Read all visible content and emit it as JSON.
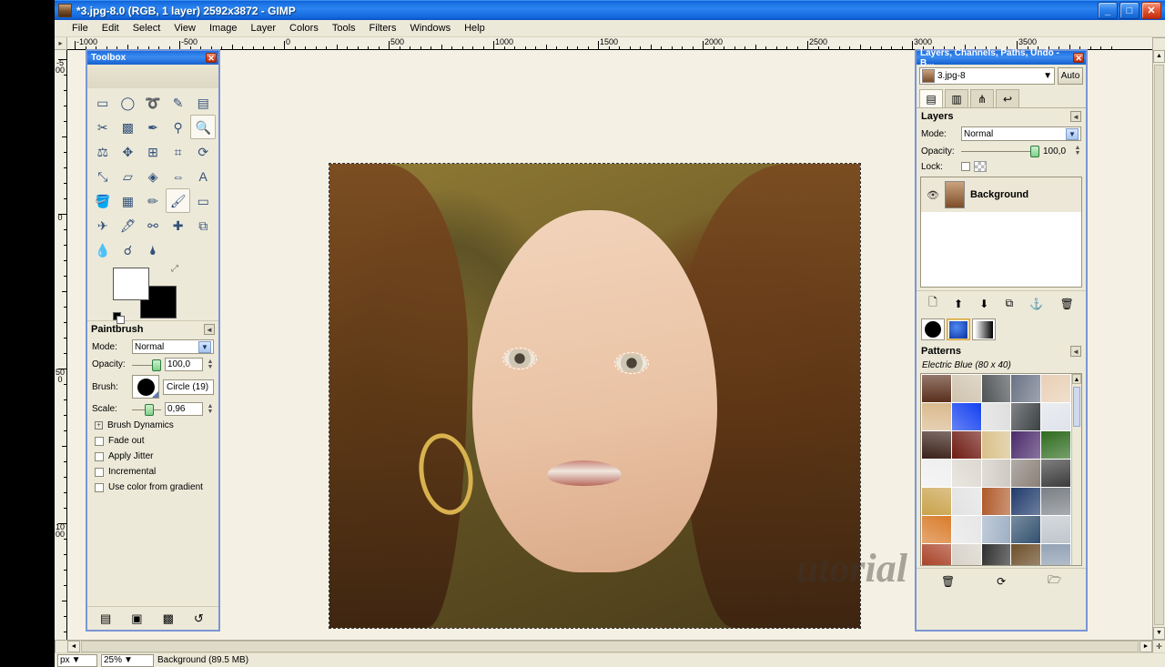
{
  "window": {
    "title": "*3.jpg-8.0 (RGB, 1 layer) 2592x3872 - GIMP",
    "minimize": "_",
    "maximize": "□",
    "close": "✕"
  },
  "menu": [
    "File",
    "Edit",
    "Select",
    "View",
    "Image",
    "Layer",
    "Colors",
    "Tools",
    "Filters",
    "Windows",
    "Help"
  ],
  "rulers": {
    "horizontal": [
      "-1000",
      "-500",
      "0",
      "500",
      "1000",
      "1500",
      "2000",
      "2500",
      "3000",
      "3500"
    ],
    "vertical": [
      "-500",
      "0",
      "500",
      "1000"
    ],
    "unit_menu": "▸"
  },
  "canvas": {
    "watermark": "utorial"
  },
  "toolbox": {
    "title": "Toolbox",
    "close": "✕",
    "tools": [
      {
        "name": "rect-select-tool",
        "glyph": "▭"
      },
      {
        "name": "ellipse-select-tool",
        "glyph": "◯"
      },
      {
        "name": "free-select-tool",
        "glyph": "➰"
      },
      {
        "name": "fuzzy-select-tool",
        "glyph": "✎"
      },
      {
        "name": "select-by-color-tool",
        "glyph": "▤"
      },
      {
        "name": "scissors-select-tool",
        "glyph": "✂"
      },
      {
        "name": "foreground-select-tool",
        "glyph": "▩"
      },
      {
        "name": "paths-tool",
        "glyph": "✒"
      },
      {
        "name": "color-picker-tool",
        "glyph": "⚲"
      },
      {
        "name": "zoom-tool",
        "glyph": "🔍"
      },
      {
        "name": "measure-tool",
        "glyph": "⚖"
      },
      {
        "name": "move-tool",
        "glyph": "✥"
      },
      {
        "name": "align-tool",
        "glyph": "⊞"
      },
      {
        "name": "crop-tool",
        "glyph": "⌗"
      },
      {
        "name": "rotate-tool",
        "glyph": "⟳"
      },
      {
        "name": "scale-tool",
        "glyph": "⤡"
      },
      {
        "name": "shear-tool",
        "glyph": "▱"
      },
      {
        "name": "perspective-tool",
        "glyph": "◈"
      },
      {
        "name": "flip-tool",
        "glyph": "⇔"
      },
      {
        "name": "text-tool",
        "glyph": "A"
      },
      {
        "name": "bucket-fill-tool",
        "glyph": "🪣"
      },
      {
        "name": "gradient-tool",
        "glyph": "▦"
      },
      {
        "name": "pencil-tool",
        "glyph": "✏"
      },
      {
        "name": "paintbrush-tool",
        "glyph": "🖌"
      },
      {
        "name": "eraser-tool",
        "glyph": "▭"
      },
      {
        "name": "airbrush-tool",
        "glyph": "✈"
      },
      {
        "name": "ink-tool",
        "glyph": "🖋"
      },
      {
        "name": "clone-tool",
        "glyph": "⚯"
      },
      {
        "name": "heal-tool",
        "glyph": "✚"
      },
      {
        "name": "perspective-clone-tool",
        "glyph": "⧉"
      },
      {
        "name": "blur-sharpen-tool",
        "glyph": "💧"
      },
      {
        "name": "smudge-tool",
        "glyph": "☌"
      },
      {
        "name": "dodge-burn-tool",
        "glyph": "🌢"
      }
    ],
    "selected_tool_index": 23,
    "zoom_tool_index": 9,
    "colors": {
      "foreground": "#ffffff",
      "background": "#000000",
      "swap_icon": "swap-colors-icon"
    },
    "bottom_buttons": [
      {
        "name": "save-options-button",
        "glyph": "▤"
      },
      {
        "name": "restore-options-button",
        "glyph": "▣"
      },
      {
        "name": "delete-options-button",
        "glyph": "▩"
      },
      {
        "name": "reset-options-button",
        "glyph": "↺"
      }
    ]
  },
  "tool_options": {
    "title": "Paintbrush",
    "collapse": "◄",
    "mode": {
      "label": "Mode:",
      "value": "Normal"
    },
    "opacity": {
      "label": "Opacity:",
      "value": "100,0"
    },
    "brush": {
      "label": "Brush:",
      "value": "Circle (19)"
    },
    "scale": {
      "label": "Scale:",
      "value": "0,96"
    },
    "brush_dynamics": {
      "label": "Brush Dynamics",
      "expander": "+"
    },
    "checkboxes": [
      {
        "label": "Fade out",
        "checked": false
      },
      {
        "label": "Apply Jitter",
        "checked": false
      },
      {
        "label": "Incremental",
        "checked": false
      },
      {
        "label": "Use color from gradient",
        "checked": false
      }
    ]
  },
  "dock": {
    "title": "Layers, Channels, Paths, Undo - B...",
    "close": "✕",
    "image_selector": {
      "value": "3.jpg-8",
      "dropdown": "▼"
    },
    "auto_button": "Auto",
    "tabs": [
      {
        "name": "layers-tab",
        "glyph": "▤"
      },
      {
        "name": "channels-tab",
        "glyph": "▥"
      },
      {
        "name": "paths-tab",
        "glyph": "⋔"
      },
      {
        "name": "undo-history-tab",
        "glyph": "↩"
      }
    ],
    "active_tab_index": 0,
    "layers": {
      "title": "Layers",
      "collapse": "◄",
      "mode": {
        "label": "Mode:",
        "value": "Normal"
      },
      "opacity": {
        "label": "Opacity:",
        "value": "100,0"
      },
      "lock": {
        "label": "Lock:",
        "alpha_icon": "lock-alpha-icon"
      },
      "items": [
        {
          "name": "Background",
          "visible": true,
          "eye_icon": "eye-icon"
        }
      ]
    },
    "layer_buttons": [
      {
        "name": "new-layer-button",
        "glyph": "🗋"
      },
      {
        "name": "raise-layer-button",
        "glyph": "⬆"
      },
      {
        "name": "lower-layer-button",
        "glyph": "⬇"
      },
      {
        "name": "duplicate-layer-button",
        "glyph": "⧉"
      },
      {
        "name": "anchor-layer-button",
        "glyph": "⚓"
      },
      {
        "name": "delete-layer-button",
        "glyph": "🗑"
      }
    ],
    "brush_tabs": [
      {
        "name": "brushes-tab",
        "glyph": "●"
      },
      {
        "name": "patterns-tab",
        "glyph": "▨"
      },
      {
        "name": "gradients-tab",
        "glyph": "▰"
      }
    ],
    "brush_tabs_active_index": 1,
    "patterns": {
      "title": "Patterns",
      "collapse": "◄",
      "selected": "Electric Blue (80 x 40)",
      "scroll_up": "▲",
      "swatches": [
        "#5a2f1c",
        "#cfc3ad",
        "#4e5355",
        "#6a7385",
        "#e8cfb3",
        "#d9b98c",
        "#1340f0",
        "#dedede",
        "#3c4144",
        "#dfe3ea",
        "#3a2018",
        "#6e1a12",
        "#d9c08a",
        "#4a2a6b",
        "#2e6b1e",
        "#efefef",
        "#ddd8d0",
        "#cfcac2",
        "#8a8078",
        "#3b3b3b",
        "#c9a24a",
        "#e2e2e2",
        "#b05a2a",
        "#203a6b",
        "#7a7f85",
        "#d97b2a",
        "#e6e6e6",
        "#9fb0c4",
        "#31506e",
        "#c0c6cc",
        "#a63a1e",
        "#d6d1c7",
        "#2f2f2f",
        "#6d4f2a",
        "#93a3b5"
      ],
      "bottom_buttons": [
        {
          "name": "delete-pattern-button",
          "glyph": "🗑"
        },
        {
          "name": "refresh-patterns-button",
          "glyph": "⟳"
        },
        {
          "name": "open-pattern-folder-button",
          "glyph": "🗁"
        }
      ]
    }
  },
  "statusbar": {
    "unit": "px",
    "zoom": "25%",
    "info": "Background (89.5 MB)"
  },
  "scrollbars": {
    "up": "▲",
    "down": "▼",
    "left": "◄",
    "right": "►",
    "nav_icon": "navigate-icon",
    "quickmask_icon": "quick-mask-icon"
  },
  "colors": {
    "title_blue": "#2b84ef",
    "panel_bg": "#ece9d8",
    "canvas_bg": "#f4f1e4"
  }
}
